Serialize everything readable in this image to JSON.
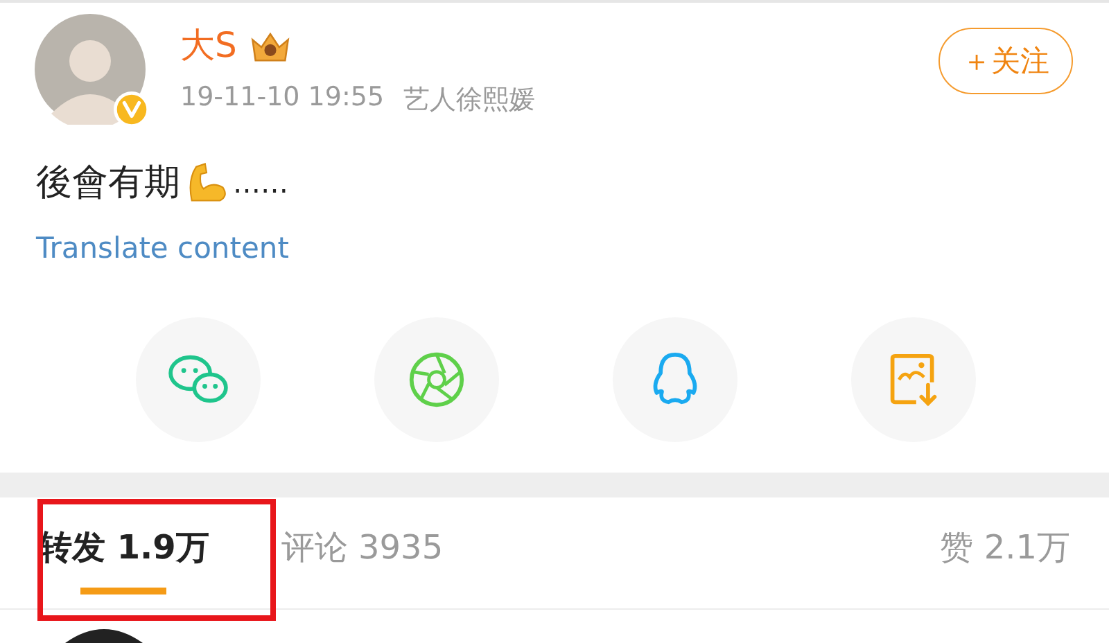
{
  "author": {
    "name": "大S",
    "verified": true,
    "time": "19-11-10 19:55",
    "source": "艺人徐熙媛"
  },
  "follow_button": {
    "label": "＋关注"
  },
  "post": {
    "text": "後會有期",
    "trailing": "……",
    "translate": "Translate content"
  },
  "share": [
    {
      "kind": "wechat"
    },
    {
      "kind": "moments"
    },
    {
      "kind": "qq"
    },
    {
      "kind": "save-image"
    }
  ],
  "tabs": [
    {
      "label": "转发 1.9万",
      "selected": true
    },
    {
      "label": "评论 3935",
      "selected": false
    },
    {
      "label": "赞 2.1万",
      "selected": false
    }
  ]
}
